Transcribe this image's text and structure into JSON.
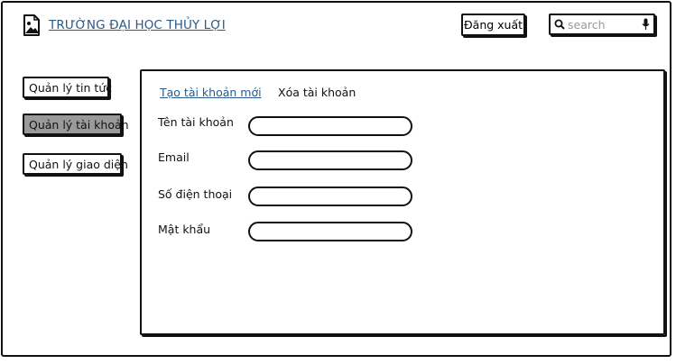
{
  "header": {
    "title": "TRƯỜNG ĐẠI HỌC THỦY LỢI",
    "logout_label": "Đăng xuất",
    "search": {
      "placeholder": "search",
      "value": ""
    }
  },
  "sidebar": {
    "items": [
      {
        "label": "Quản lý tin tức",
        "active": false
      },
      {
        "label": "Quản lý tài khoản",
        "active": true
      },
      {
        "label": "Quản lý giao diện",
        "active": false
      }
    ]
  },
  "main": {
    "tabs": [
      {
        "label": "Tạo tài khoản mới",
        "active": true
      },
      {
        "label": "Xóa tài khoản",
        "active": false
      }
    ],
    "form": {
      "fields": [
        {
          "label": "Tên tài khoản",
          "value": ""
        },
        {
          "label": "Email",
          "value": ""
        },
        {
          "label": "Số điện thoại",
          "value": ""
        },
        {
          "label": "Mật khẩu",
          "value": ""
        }
      ]
    }
  },
  "colors": {
    "link": "#2a5a8c",
    "active_nav": "#9a9a9a",
    "border": "#111111"
  },
  "icons": {
    "logo": "image-file-icon",
    "search": "magnifier-icon",
    "mic": "microphone-icon"
  }
}
